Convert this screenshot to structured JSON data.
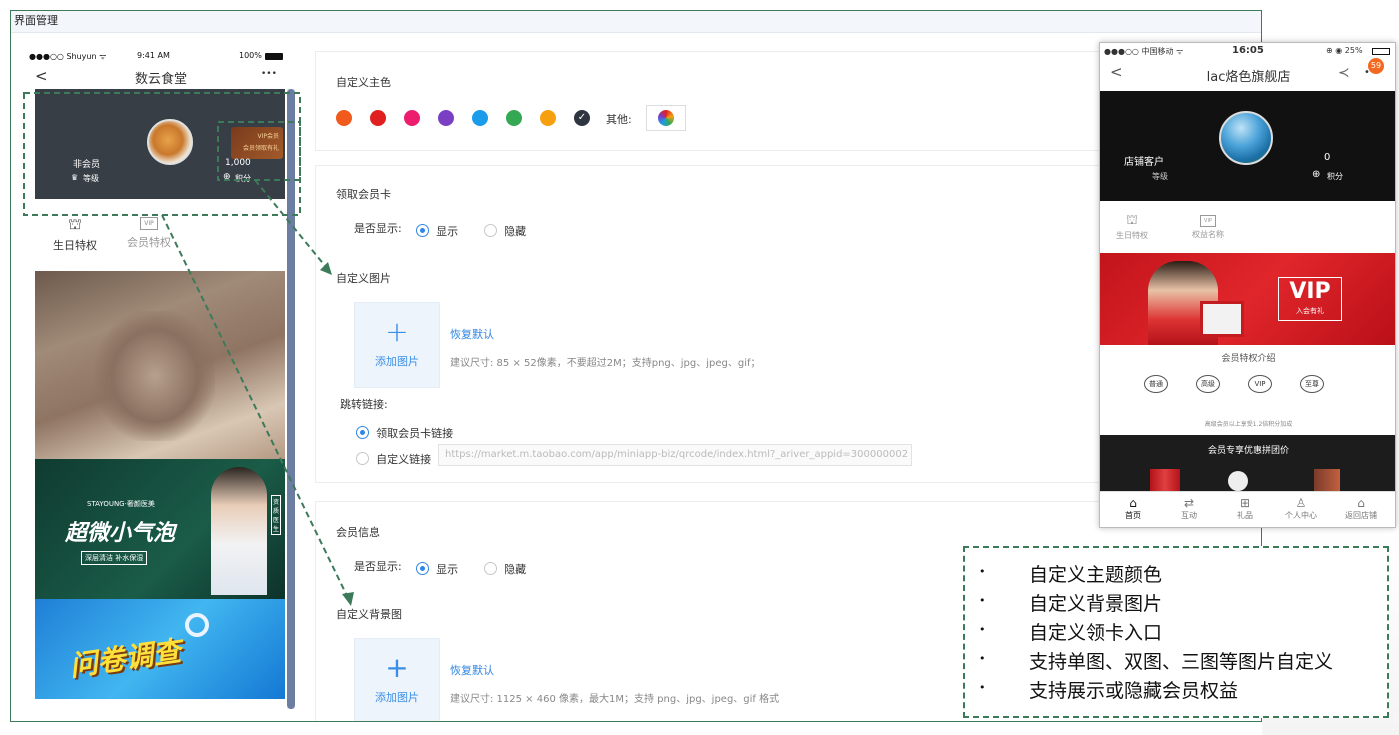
{
  "admin": {
    "title": "界面管理"
  },
  "left_phone": {
    "carrier": "●●●○○ Shuyun ᯤ",
    "time": "9:41 AM",
    "battery": "100%",
    "back": "<",
    "title": "数云食堂",
    "more": "•••",
    "member_status": "非会员",
    "level_label": "等级",
    "points_value": "1,000",
    "points_label": "积分",
    "vip_badge_line1": "VIP会员",
    "vip_badge_line2": "会员领取有礼",
    "privileges": [
      {
        "label": "生日特权",
        "icon": "cake-icon",
        "active": true
      },
      {
        "label": "会员特权",
        "icon": "vip-card-icon",
        "active": false
      }
    ],
    "banner2": {
      "brand": "STAYOUNG·奢颜医美",
      "headline": "超微小气泡",
      "sub": "深层清洁 补水保湿",
      "tag": "资质医生"
    },
    "banner3": {
      "headline": "问卷调查"
    }
  },
  "theme": {
    "title": "自定义主色",
    "colors": [
      "#f05a1c",
      "#e02020",
      "#ec1d6c",
      "#7b3fc4",
      "#1b9ceb",
      "#34a853",
      "#f6a010",
      "#2e3440"
    ],
    "selected_index": 7,
    "other_label": "其他:"
  },
  "card_section": {
    "title": "领取会员卡",
    "show_label": "是否显示:",
    "show_option": "显示",
    "hide_option": "隐藏",
    "image_title": "自定义图片",
    "add_image": "添加图片",
    "restore": "恢复默认",
    "hint": "建议尺寸: 85 × 52像素，不要超过2M；支持png、jpg、jpeg、gif；",
    "link_title": "跳转链接:",
    "link_option1": "领取会员卡链接",
    "link_option2": "自定义链接",
    "url": "https://market.m.taobao.com/app/miniapp-biz/qrcode/index.html?_ariver_appid=300000002"
  },
  "info_section": {
    "title": "会员信息",
    "show_label": "是否显示:",
    "show_option": "显示",
    "hide_option": "隐藏",
    "bg_title": "自定义背景图",
    "add_image": "添加图片",
    "restore": "恢复默认",
    "hint": "建议尺寸: 1125 × 460 像素，最大1M；支持 png、jpg、jpeg、gif 格式"
  },
  "right_phone": {
    "carrier": "●●●○○ 中国移动 ᯤ",
    "time": "16:05",
    "battery": "⊕ ◉ 25%",
    "back": "<",
    "title": "lac烙色旗舰店",
    "badge": "59",
    "member_status": "店铺客户",
    "level_label": "等级",
    "points_value": "0",
    "points_label": "积分",
    "privileges": [
      {
        "label": "生日特权",
        "icon": "cake-icon"
      },
      {
        "label": "权益名称",
        "icon": "vip-card-icon"
      }
    ],
    "vip_title": "VIP",
    "vip_sub": "入会有礼",
    "intro_title": "会员特权介绍",
    "tiers": [
      "普通",
      "高级",
      "VIP",
      "至尊"
    ],
    "intro_note": "高级会员以上享受1.2倍积分加成",
    "deal_title": "会员专享优惠拼团价",
    "tabs": [
      {
        "label": "首页",
        "icon": "home-icon",
        "glyph": "⌂"
      },
      {
        "label": "互动",
        "icon": "interact-icon",
        "glyph": "⇄"
      },
      {
        "label": "礼品",
        "icon": "gift-icon",
        "glyph": "⊞"
      },
      {
        "label": "个人中心",
        "icon": "person-icon",
        "glyph": "♙"
      },
      {
        "label": "返回店铺",
        "icon": "store-icon",
        "glyph": "⌂"
      }
    ]
  },
  "features": [
    "自定义主题颜色",
    "自定义背景图片",
    "自定义领卡入口",
    "支持单图、双图、三图等图片自定义",
    "支持展示或隐藏会员权益"
  ]
}
